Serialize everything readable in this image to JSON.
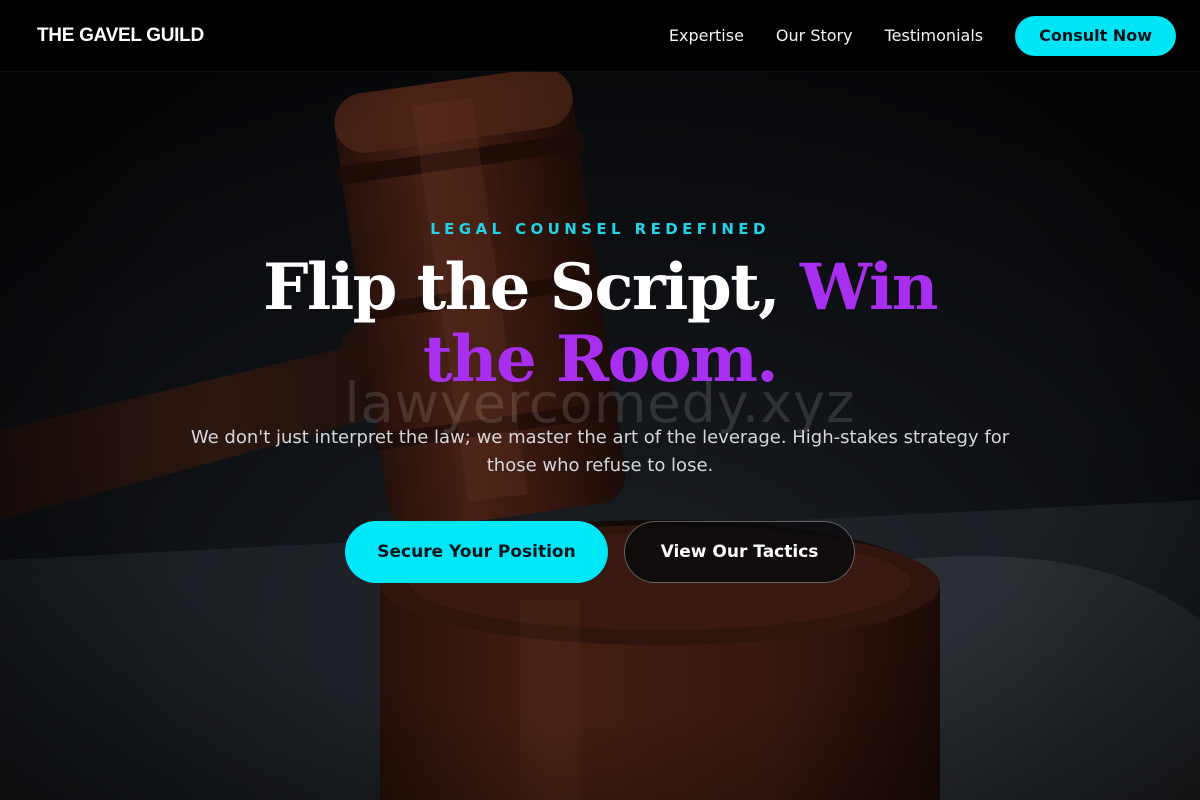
{
  "colors": {
    "accent_cyan": "#00e5f5",
    "accent_purple": "#a92ff0",
    "eyebrow_cyan": "#22d3e6",
    "background": "#0c0d10"
  },
  "nav": {
    "brand": "THE GAVEL GUILD",
    "links": [
      "Expertise",
      "Our Story",
      "Testimonials"
    ],
    "cta_label": "Consult Now"
  },
  "hero": {
    "background_image": "gavel-photo",
    "eyebrow": "LEGAL COUNSEL REDEFINED",
    "headline_part1": "Flip the Script, ",
    "headline_accent": "Win the Room.",
    "watermark": "lawyercomedy.xyz",
    "subtext": "We don't just interpret the law; we master the art of the leverage. High-stakes strategy for those who refuse to lose.",
    "primary_button": "Secure Your Position",
    "secondary_button": "View Our Tactics"
  }
}
